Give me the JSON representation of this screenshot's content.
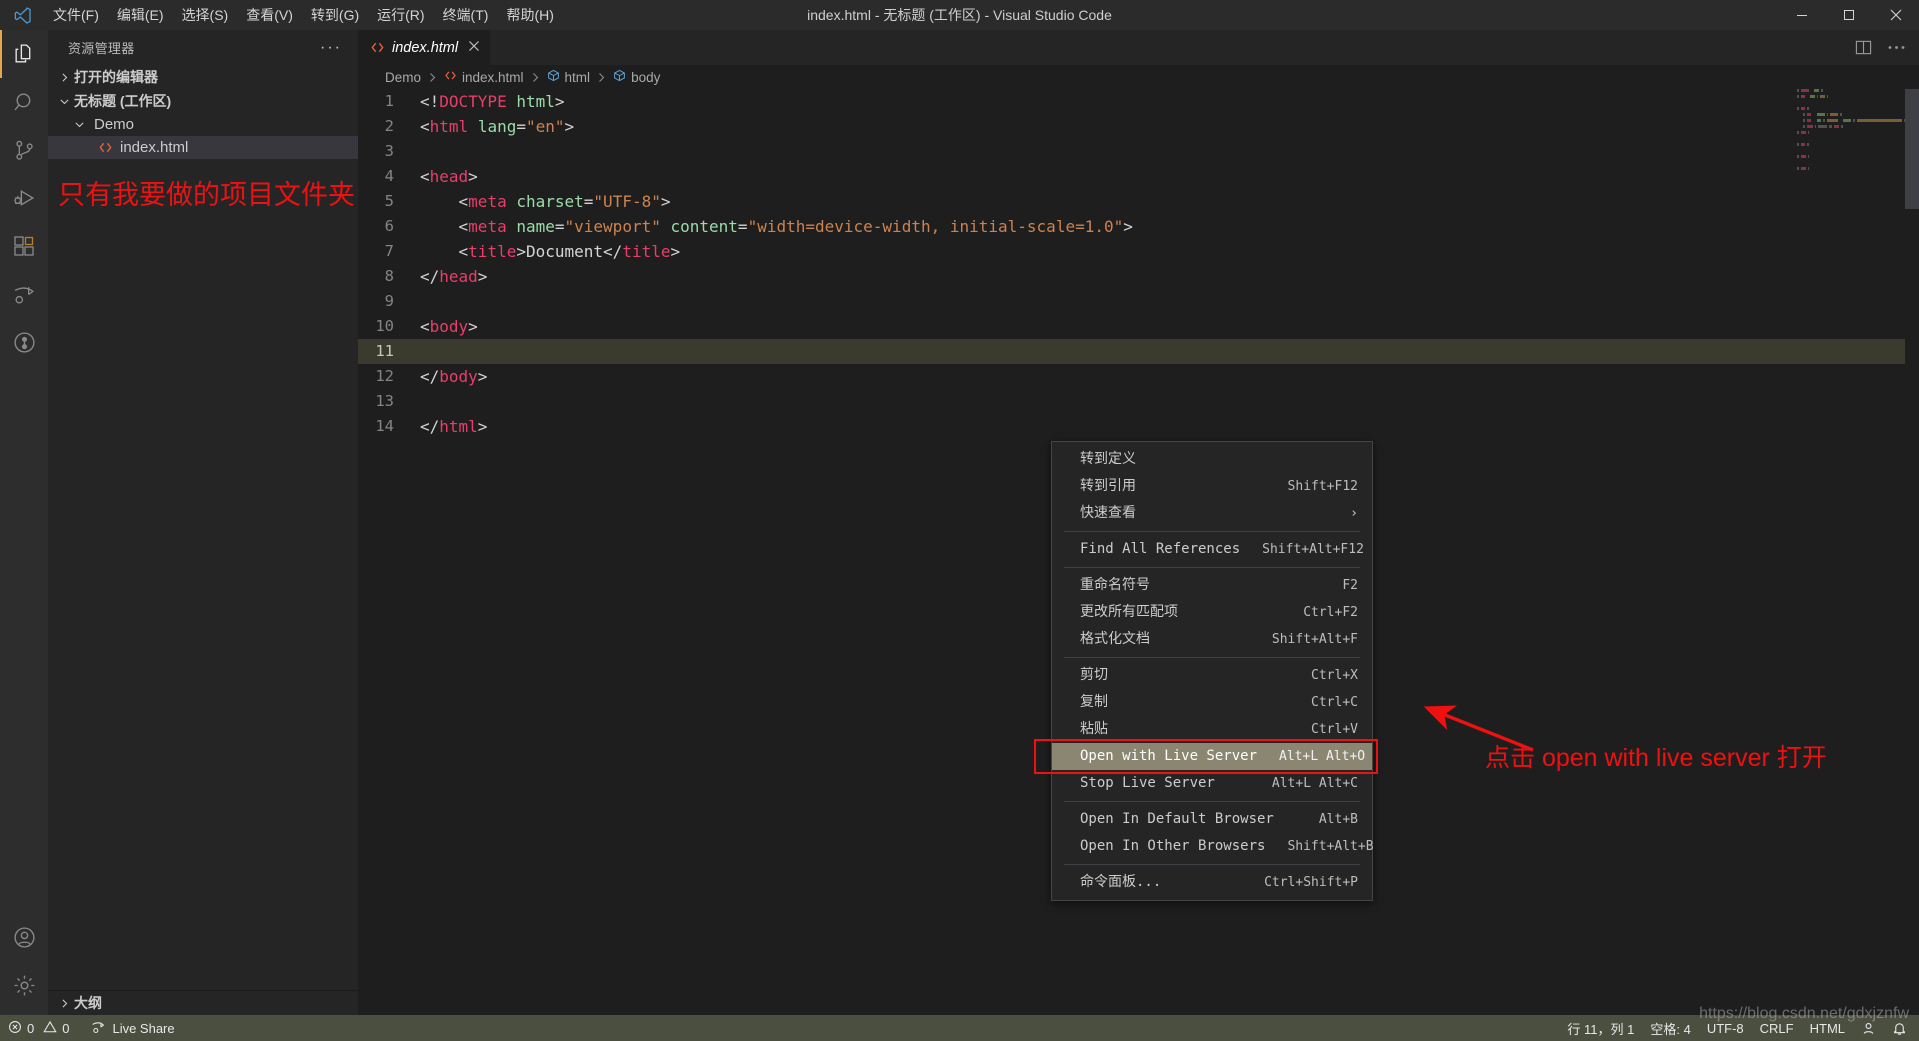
{
  "titlebar": {
    "logo_icon": "vscode-logo-icon",
    "menus": [
      {
        "label": "文件(F)"
      },
      {
        "label": "编辑(E)"
      },
      {
        "label": "选择(S)"
      },
      {
        "label": "查看(V)"
      },
      {
        "label": "转到(G)"
      },
      {
        "label": "运行(R)"
      },
      {
        "label": "终端(T)"
      },
      {
        "label": "帮助(H)"
      }
    ],
    "window_title": "index.html - 无标题 (工作区) - Visual Studio Code",
    "minimize_icon": "minimize-icon",
    "maximize_icon": "maximize-icon",
    "close_icon": "close-icon"
  },
  "activitybar": {
    "items": [
      {
        "name": "explorer-icon",
        "active": true
      },
      {
        "name": "search-icon",
        "active": false
      },
      {
        "name": "source-control-icon",
        "active": false
      },
      {
        "name": "run-and-debug-icon",
        "active": false
      },
      {
        "name": "extensions-icon",
        "active": false
      },
      {
        "name": "live-share-icon",
        "active": false
      },
      {
        "name": "remote-explorer-icon",
        "active": false
      }
    ],
    "bottom_items": [
      {
        "name": "accounts-icon"
      },
      {
        "name": "settings-gear-icon"
      }
    ]
  },
  "sidebar": {
    "title": "资源管理器",
    "more_actions": "···",
    "sections": [
      {
        "label": "打开的编辑器",
        "expanded": false
      },
      {
        "label": "无标题 (工作区)",
        "expanded": true
      }
    ],
    "tree": [
      {
        "label": "Demo",
        "type": "folder",
        "expanded": true,
        "indent": 1
      },
      {
        "label": "index.html",
        "type": "html-file",
        "selected": true,
        "indent": 2
      }
    ],
    "annotation": "只有我要做的项目文件夹",
    "outline_label": "大纲"
  },
  "editor": {
    "tab": {
      "label": "index.html",
      "icon": "html-file-icon",
      "close_icon": "close-icon",
      "dirty": false
    },
    "tab_actions": [
      {
        "name": "split-editor-icon"
      },
      {
        "name": "more-actions-icon",
        "label": "···"
      }
    ],
    "breadcrumbs": [
      {
        "label": "Demo",
        "icon": "none"
      },
      {
        "label": "index.html",
        "icon": "html-file-icon"
      },
      {
        "label": "html",
        "icon": "symbol-field-icon"
      },
      {
        "label": "body",
        "icon": "symbol-field-icon"
      }
    ],
    "breadcrumb_separator": "›",
    "lines": [
      {
        "n": "1",
        "tokens": [
          {
            "t": "punc",
            "v": "<!"
          },
          {
            "t": "tag",
            "v": "DOCTYPE"
          },
          {
            "t": "text",
            "v": " "
          },
          {
            "t": "attr",
            "v": "html"
          },
          {
            "t": "punc",
            "v": ">"
          }
        ]
      },
      {
        "n": "2",
        "tokens": [
          {
            "t": "punc",
            "v": "<"
          },
          {
            "t": "tag",
            "v": "html"
          },
          {
            "t": "text",
            "v": " "
          },
          {
            "t": "attr",
            "v": "lang"
          },
          {
            "t": "punc",
            "v": "="
          },
          {
            "t": "str",
            "v": "\"en\""
          },
          {
            "t": "punc",
            "v": ">"
          }
        ]
      },
      {
        "n": "3",
        "tokens": []
      },
      {
        "n": "4",
        "tokens": [
          {
            "t": "punc",
            "v": "<"
          },
          {
            "t": "tag",
            "v": "head"
          },
          {
            "t": "punc",
            "v": ">"
          }
        ]
      },
      {
        "n": "5",
        "tokens": [
          {
            "t": "text",
            "v": "    "
          },
          {
            "t": "punc",
            "v": "<"
          },
          {
            "t": "tag",
            "v": "meta"
          },
          {
            "t": "text",
            "v": " "
          },
          {
            "t": "attr",
            "v": "charset"
          },
          {
            "t": "punc",
            "v": "="
          },
          {
            "t": "str",
            "v": "\"UTF-8\""
          },
          {
            "t": "punc",
            "v": ">"
          }
        ]
      },
      {
        "n": "6",
        "tokens": [
          {
            "t": "text",
            "v": "    "
          },
          {
            "t": "punc",
            "v": "<"
          },
          {
            "t": "tag",
            "v": "meta"
          },
          {
            "t": "text",
            "v": " "
          },
          {
            "t": "attr",
            "v": "name"
          },
          {
            "t": "punc",
            "v": "="
          },
          {
            "t": "str",
            "v": "\"viewport\""
          },
          {
            "t": "text",
            "v": " "
          },
          {
            "t": "attr",
            "v": "content"
          },
          {
            "t": "punc",
            "v": "="
          },
          {
            "t": "str",
            "v": "\"width=device-width, initial-scale=1.0\""
          },
          {
            "t": "punc",
            "v": ">"
          }
        ]
      },
      {
        "n": "7",
        "tokens": [
          {
            "t": "text",
            "v": "    "
          },
          {
            "t": "punc",
            "v": "<"
          },
          {
            "t": "tag",
            "v": "title"
          },
          {
            "t": "punc",
            "v": ">"
          },
          {
            "t": "text",
            "v": "Document"
          },
          {
            "t": "punc",
            "v": "</"
          },
          {
            "t": "tag",
            "v": "title"
          },
          {
            "t": "punc",
            "v": ">"
          }
        ]
      },
      {
        "n": "8",
        "tokens": [
          {
            "t": "punc",
            "v": "</"
          },
          {
            "t": "tag",
            "v": "head"
          },
          {
            "t": "punc",
            "v": ">"
          }
        ]
      },
      {
        "n": "9",
        "tokens": []
      },
      {
        "n": "10",
        "tokens": [
          {
            "t": "punc",
            "v": "<"
          },
          {
            "t": "tag",
            "v": "body"
          },
          {
            "t": "punc",
            "v": ">"
          }
        ]
      },
      {
        "n": "11",
        "tokens": [],
        "current": true
      },
      {
        "n": "12",
        "tokens": [
          {
            "t": "punc",
            "v": "</"
          },
          {
            "t": "tag",
            "v": "body"
          },
          {
            "t": "punc",
            "v": ">"
          }
        ]
      },
      {
        "n": "13",
        "tokens": []
      },
      {
        "n": "14",
        "tokens": [
          {
            "t": "punc",
            "v": "</"
          },
          {
            "t": "tag",
            "v": "html"
          },
          {
            "t": "punc",
            "v": ">"
          }
        ]
      }
    ]
  },
  "contextmenu": {
    "items": [
      {
        "label": "转到定义",
        "key": ""
      },
      {
        "label": "转到引用",
        "key": "Shift+F12"
      },
      {
        "label": "快速查看",
        "key": "",
        "submenu": "›"
      },
      {
        "type": "separator"
      },
      {
        "label": "Find All References",
        "key": "Shift+Alt+F12"
      },
      {
        "type": "separator"
      },
      {
        "label": "重命名符号",
        "key": "F2"
      },
      {
        "label": "更改所有匹配项",
        "key": "Ctrl+F2"
      },
      {
        "label": "格式化文档",
        "key": "Shift+Alt+F"
      },
      {
        "type": "separator"
      },
      {
        "label": "剪切",
        "key": "Ctrl+X"
      },
      {
        "label": "复制",
        "key": "Ctrl+C"
      },
      {
        "label": "粘贴",
        "key": "Ctrl+V"
      },
      {
        "label": "Open with Live Server",
        "key": "Alt+L Alt+O",
        "highlight": true
      },
      {
        "label": "Stop Live Server",
        "key": "Alt+L Alt+C"
      },
      {
        "type": "separator"
      },
      {
        "label": "Open In Default Browser",
        "key": "Alt+B"
      },
      {
        "label": "Open In Other Browsers",
        "key": "Shift+Alt+B"
      },
      {
        "type": "separator"
      },
      {
        "label": "命令面板...",
        "key": "Ctrl+Shift+P"
      }
    ]
  },
  "annotations": {
    "arrow_color": "#ee1111",
    "callout": "点击 open with live server 打开"
  },
  "statusbar": {
    "left": [
      {
        "name": "problems-status",
        "icon": "error-icon",
        "errors": "0",
        "warn_icon": "warning-icon",
        "warnings": "0"
      },
      {
        "name": "live-share-status",
        "icon": "live-share-icon",
        "label": "Live Share"
      }
    ],
    "right": [
      {
        "name": "cursor-position",
        "label": "行 11，列 1"
      },
      {
        "name": "indentation",
        "label": "空格: 4"
      },
      {
        "name": "encoding",
        "label": "UTF-8"
      },
      {
        "name": "eol",
        "label": "CRLF"
      },
      {
        "name": "language-mode",
        "label": "HTML"
      },
      {
        "name": "live-share-account",
        "icon": "account-icon"
      },
      {
        "name": "notifications",
        "icon": "bell-icon"
      }
    ]
  },
  "watermark": "https://blog.csdn.net/gdxjznfw"
}
